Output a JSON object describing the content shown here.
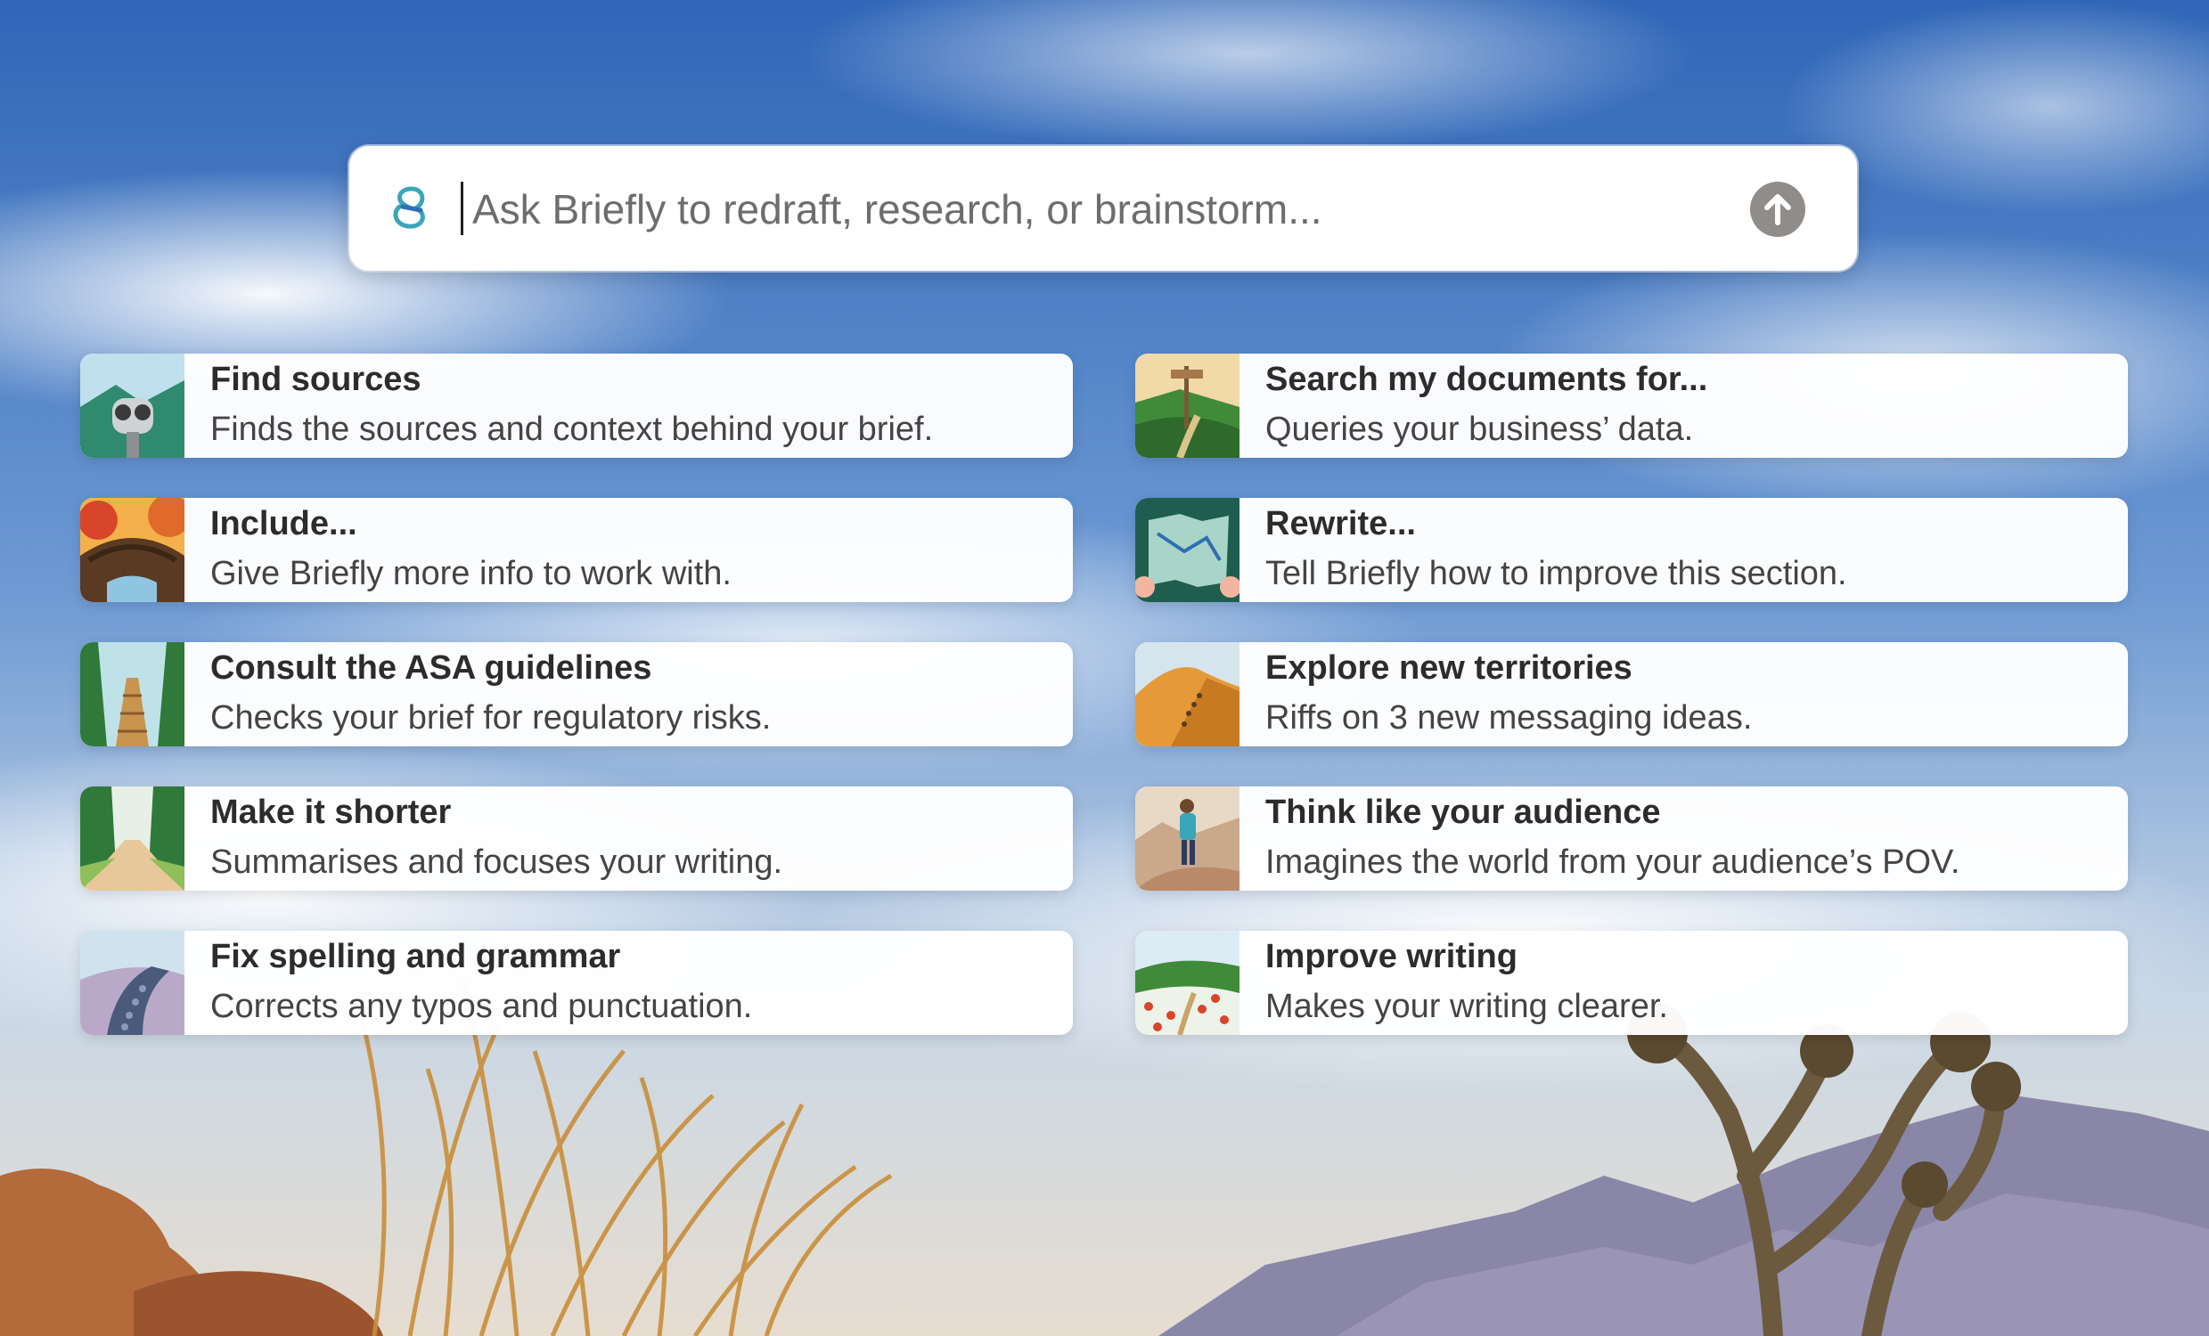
{
  "search": {
    "placeholder": "Ask Briefly to redraft, research, or brainstorm..."
  },
  "icons": {
    "logo": "briefly-logo-icon",
    "send": "arrow-up-icon"
  },
  "colors": {
    "accent_teal": "#3aa6b9",
    "accent_blue": "#2f6fb3",
    "send_button": "#8f8c8a"
  },
  "actions": [
    {
      "title": "Find sources",
      "description": "Finds the sources and context behind your brief.",
      "image": "binoculars-illustration"
    },
    {
      "title": "Search my documents for...",
      "description": "Queries your business’ data.",
      "image": "signpost-illustration"
    },
    {
      "title": "Include...",
      "description": "Give Briefly more info to work with.",
      "image": "bridge-illustration"
    },
    {
      "title": "Rewrite...",
      "description": "Tell Briefly how to improve this section.",
      "image": "map-illustration"
    },
    {
      "title": "Consult the ASA guidelines",
      "description": "Checks your brief for regulatory risks.",
      "image": "forest-bridge-illustration"
    },
    {
      "title": "Explore new territories",
      "description": "Riffs on 3 new messaging ideas.",
      "image": "desert-dunes-illustration"
    },
    {
      "title": "Make it shorter",
      "description": "Summarises and focuses your writing.",
      "image": "tree-lined-path-illustration"
    },
    {
      "title": "Think like your audience",
      "description": "Imagines the world from your audience’s POV.",
      "image": "hiker-illustration"
    },
    {
      "title": "Fix spelling and grammar",
      "description": "Corrects any typos and punctuation.",
      "image": "cobblestone-path-illustration"
    },
    {
      "title": "Improve writing",
      "description": "Makes your writing clearer.",
      "image": "flower-meadow-illustration"
    }
  ]
}
